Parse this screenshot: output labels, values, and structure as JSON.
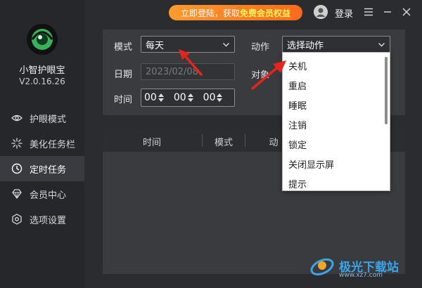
{
  "sidebar": {
    "app_name": "小智护眼宝",
    "version": "V2.0.16.26",
    "items": [
      {
        "label": "护眼模式",
        "icon": "eye-icon"
      },
      {
        "label": "美化任务栏",
        "icon": "sparkle-icon"
      },
      {
        "label": "定时任务",
        "icon": "clock-icon",
        "active": true
      },
      {
        "label": "会员中心",
        "icon": "diamond-icon"
      },
      {
        "label": "选项设置",
        "icon": "gear-icon"
      }
    ]
  },
  "topbar": {
    "promo_prefix": "立即登陆，获取",
    "promo_highlight": "免费会员权益",
    "login_label": "登录"
  },
  "form": {
    "mode_label": "模式",
    "mode_value": "每天",
    "date_label": "日期",
    "date_value": "2023/02/08",
    "time_label": "时间",
    "time_h": "00",
    "time_m": "00",
    "time_s": "00",
    "action_label": "动作",
    "action_placeholder": "选择动作",
    "target_label": "对象"
  },
  "action_options": [
    "关机",
    "重启",
    "睡眠",
    "注销",
    "锁定",
    "关闭显示屏",
    "提示"
  ],
  "table": {
    "headers": [
      "时间",
      "模式",
      "动"
    ]
  },
  "watermark": {
    "text": "极光下载站",
    "sub": "www.xz7.com"
  },
  "colors": {
    "accent_promo": "#ff7a1f",
    "promo_highlight": "#fff35a",
    "annotation_arrow": "#e8231c"
  }
}
